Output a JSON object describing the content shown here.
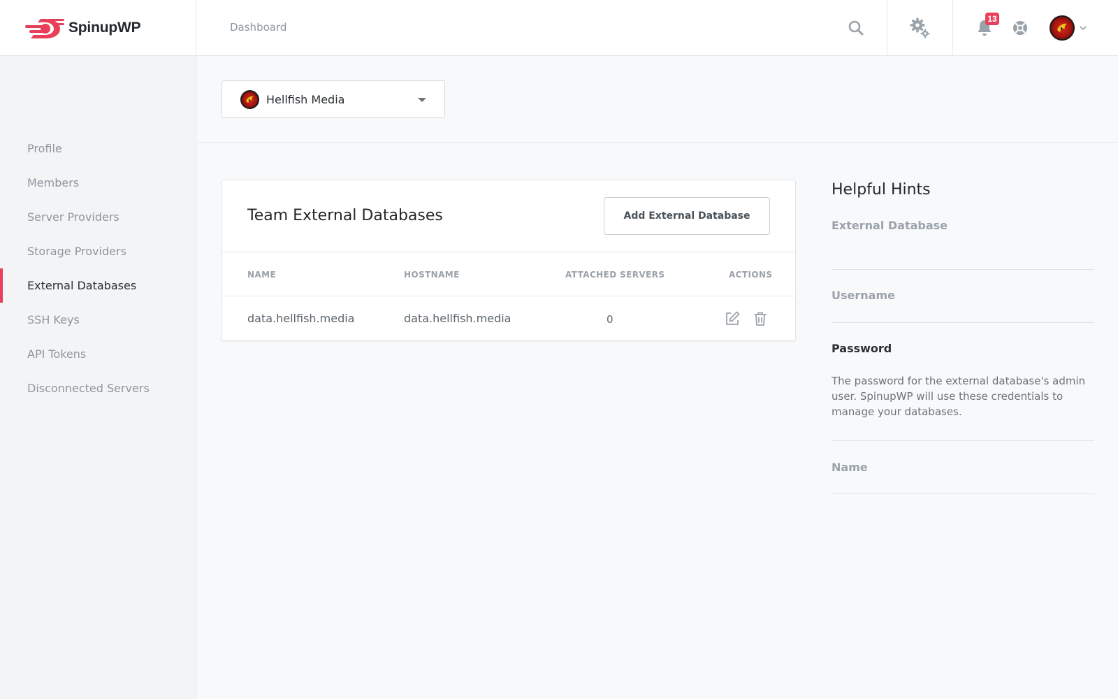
{
  "brand": {
    "name": "SpinupWP",
    "accent": "#e8405a"
  },
  "header": {
    "nav_dashboard": "Dashboard",
    "icons": [
      "search-icon",
      "settings-gears-icon",
      "bell-icon",
      "help-lifebuoy-icon",
      "chevron-down-icon"
    ],
    "notification_count": "13"
  },
  "sidebar": {
    "items": [
      {
        "label": "Profile",
        "active": false
      },
      {
        "label": "Members",
        "active": false
      },
      {
        "label": "Server Providers",
        "active": false
      },
      {
        "label": "Storage Providers",
        "active": false
      },
      {
        "label": "External Databases",
        "active": true
      },
      {
        "label": "SSH Keys",
        "active": false
      },
      {
        "label": "API Tokens",
        "active": false
      },
      {
        "label": "Disconnected Servers",
        "active": false
      }
    ]
  },
  "team_select": {
    "selected": "Hellfish Media"
  },
  "card": {
    "title": "Team External Databases",
    "add_button": "Add External Database",
    "columns": [
      "NAME",
      "HOSTNAME",
      "ATTACHED SERVERS",
      "ACTIONS"
    ],
    "rows": [
      {
        "name": "data.hellfish.media",
        "hostname": "data.hellfish.media",
        "attached_servers": "0"
      }
    ]
  },
  "hints": {
    "title": "Helpful Hints",
    "items": [
      {
        "label": "External Database",
        "active": false,
        "desc": ""
      },
      {
        "label": "Username",
        "active": false,
        "desc": ""
      },
      {
        "label": "Password",
        "active": true,
        "desc": "The password for the external database's admin user. SpinupWP will use these credentials to manage your databases."
      },
      {
        "label": "Name",
        "active": false,
        "desc": ""
      }
    ]
  }
}
